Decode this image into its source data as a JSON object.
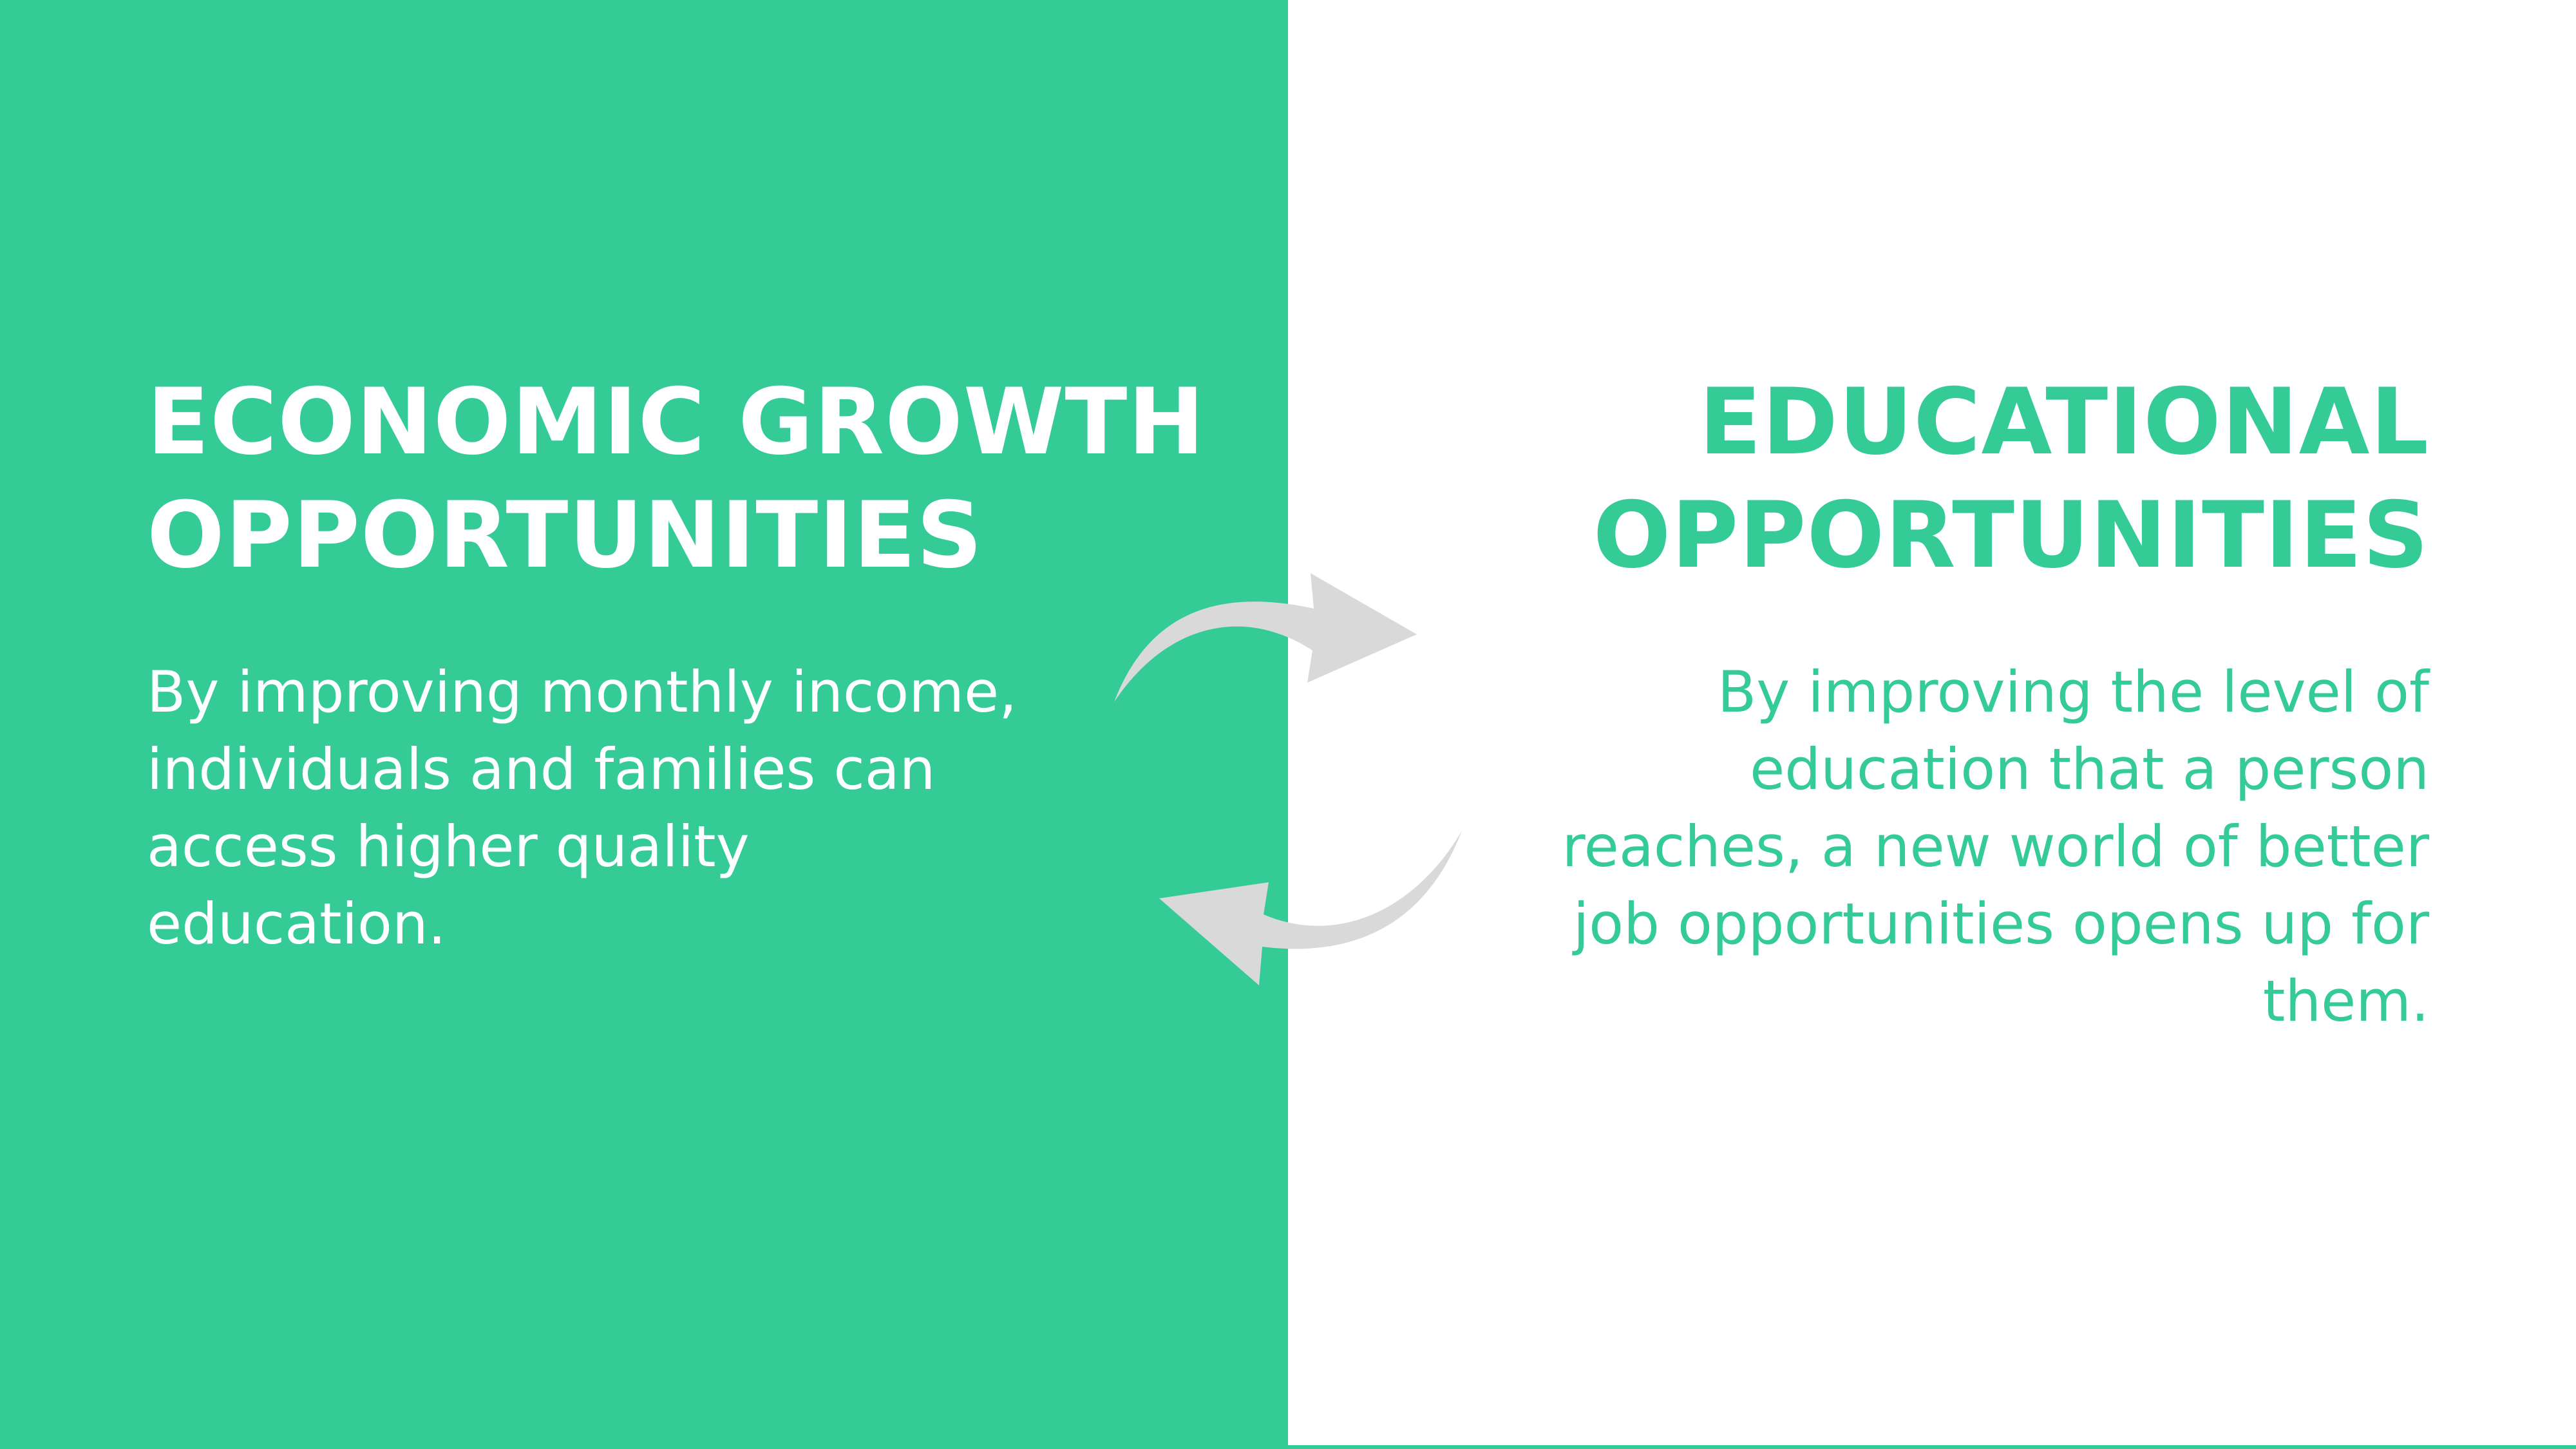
{
  "left": {
    "title_lines": [
      "ECONOMIC GROWTH",
      "OPPORTUNITIES"
    ],
    "body_lines": [
      "By improving monthly income,",
      "individuals and families can",
      "access higher quality",
      "education."
    ]
  },
  "right": {
    "title_lines": [
      "EDUCATIONAL",
      "OPPORTUNITIES"
    ],
    "body_lines": [
      "By improving the level of",
      "education that a person",
      "reaches, a new world of better",
      "job opportunities opens up for",
      "them."
    ]
  },
  "icons": {
    "top_arrow": "curved-arrow-right-icon",
    "bottom_arrow": "curved-arrow-left-icon"
  },
  "colors": {
    "accent": "#35CB97",
    "background": "#FFFFFF",
    "text_on_accent": "#FFFFFF",
    "arrow": "#D9D9D9"
  }
}
